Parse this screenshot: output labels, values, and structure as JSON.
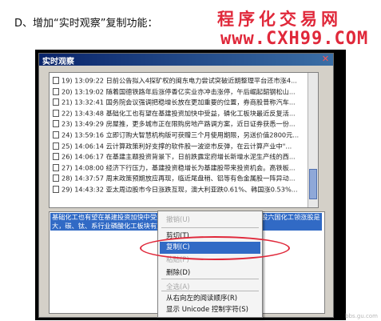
{
  "doc": {
    "heading": "D、增加“实时观察”复制功能：",
    "watermark_cn": "程序化交易网",
    "watermark_url": "www.CXH99.COM",
    "footer_watermark": "bbs.gu.com"
  },
  "window": {
    "title": "实时观察",
    "close_symbol": "✕"
  },
  "list": [
    {
      "text": "19) 13:09:22  日前公告拟入4探矿权的闽东电力尝试突破近期整理平台还市涨4..."
    },
    {
      "text": "20) 13:19:02  随着国德铁路年后涨停香亿实业亦冲击涨停，午后崛起韶钢松山..."
    },
    {
      "text": "21) 13:32:41  国务院会议强调把稳增长放在更加重要的位置，券商股昔称汽车..."
    },
    {
      "text": "22) 13:43:48  基础化工也有望在基建投资加快中受益，磷化工板块最近反复活..."
    },
    {
      "text": "23) 13:49:29  房屋推，更多城市正在限购房地产路调方案，近日证券获悉一份..."
    },
    {
      "text": "24) 13:59:16  立即订购大智慧机构版可获赠三个月使用期限，另送价值2800元..."
    },
    {
      "text": "25) 14:06:14  云计算政策利好支撑的软件股一波逆市反弹，在云计算产业中\"..."
    },
    {
      "text": "26) 14:06:17  在基建主题投资背景下，日前跌露定府增长新增水泥生产线的西..."
    },
    {
      "text": "27) 14:08:00  经济下行压力，基建投资稳增长为基建股带来投资机会。高铁板..."
    },
    {
      "text": "28) 14:37:57  周末政策预期放应再现，临近尾盘稍、铝等有色金属股一阵异动..."
    },
    {
      "text": "29) 14:43:32  亚太周边股市今日涨跌互现，澳大利亚跌0.61%、韩国涨0.53%..."
    }
  ],
  "detail": {
    "selected_text": "基础化工也有望在基建投资加快中受益，磷化工板块最近反复活跃，龙头股六国化工领涨股是大，碳、钛、系行业磷酸化工板块有望中..."
  },
  "context_menu": {
    "items": [
      {
        "label": "撤销(U)",
        "enabled": false
      },
      {
        "label": "剪切(T)",
        "enabled": true
      },
      {
        "label": "复制(C)",
        "enabled": true,
        "highlighted": true
      },
      {
        "label": "粘贴(P)",
        "enabled": false
      },
      {
        "label": "删除(D)",
        "enabled": true
      },
      {
        "label": "全选(A)",
        "enabled": false
      },
      {
        "label": "从右向左的阅读顺序(R)",
        "enabled": true
      },
      {
        "label": "显示 Unicode 控制字符(S)",
        "enabled": true
      }
    ]
  }
}
